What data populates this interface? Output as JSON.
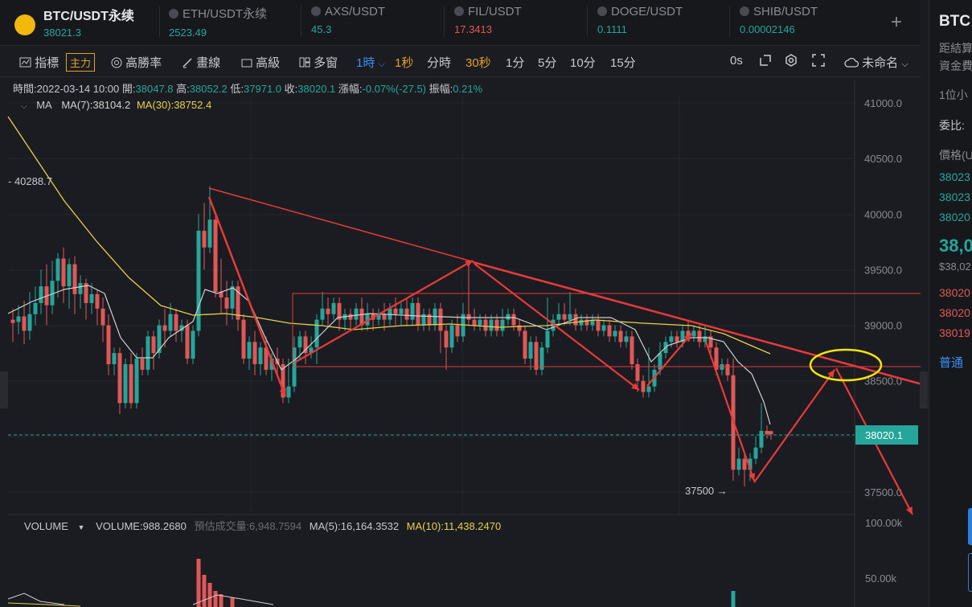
{
  "tickers": [
    {
      "name": "BTC/USDT永续",
      "price": "38021.3",
      "price_color": "#26a69a",
      "active": true
    },
    {
      "name": "ETH/USDT永续",
      "price": "2523.49",
      "price_color": "#26a69a"
    },
    {
      "name": "AXS/USDT",
      "price": "45.3",
      "price_color": "#26a69a"
    },
    {
      "name": "FIL/USDT",
      "price": "17.3413",
      "price_color": "#e05757"
    },
    {
      "name": "DOGE/USDT",
      "price": "0.1111",
      "price_color": "#26a69a"
    },
    {
      "name": "SHIB/USDT",
      "price": "0.00002146",
      "price_color": "#26a69a"
    }
  ],
  "toolbar": {
    "indicator": "指標",
    "main_badge": "主力",
    "win_rate": "高勝率",
    "draw": "畫線",
    "advanced": "高級",
    "multi_window": "多窗",
    "interval_selected": "1時",
    "intervals": [
      "1秒",
      "分時",
      "30秒",
      "1分",
      "5分",
      "10分",
      "15分"
    ],
    "time_display": "0s",
    "layout_name": "未命名"
  },
  "ohlc": {
    "time_label": "時間:",
    "time": "2022-03-14 10:00",
    "open_label": "開:",
    "open": "38047.8",
    "high_label": "高:",
    "high": "38052.2",
    "low_label": "低:",
    "low": "37971.0",
    "close_label": "收:",
    "close": "38020.1",
    "change_label": "漲幅:",
    "change": "-0.07%(-27.5)",
    "amp_label": "振幅:",
    "amp": "0.21%"
  },
  "ma": {
    "label": "MA",
    "ma7": "MA(7):38104.2",
    "ma30": "MA(30):38752.4"
  },
  "volume": {
    "label": "VOLUME",
    "value": "VOLUME:988.2680",
    "estimate": "預估成交量:6,948.7594",
    "ma5": "MA(5):16,164.3532",
    "ma10": "MA(10):11,438.2470"
  },
  "price_axis": [
    "41000.0",
    "40500.0",
    "40000.0",
    "39500.0",
    "39000.0",
    "38500.0",
    "37500.0"
  ],
  "price_axis_values": [
    41000,
    40500,
    40000,
    39500,
    39000,
    38500,
    37500
  ],
  "volume_axis": [
    "100.00k",
    "50.00k"
  ],
  "current_price": "38020.1",
  "high_marker": "40288.7",
  "low_marker": "37500",
  "colors": {
    "up": "#26a69a",
    "down": "#e05757",
    "ma7": "#d0d0d0",
    "ma30": "#e6d14a",
    "annotation": "#e83a3a",
    "circle": "#f2e600",
    "accent": "#3b8ff5"
  },
  "right_panel": {
    "symbol": "BTC",
    "settle": "距結算",
    "fee": "資金費",
    "precision": "1位小",
    "ratio": "委比:",
    "price_header": "價格(U",
    "asks_green": [
      "38023",
      "38023",
      "38020"
    ],
    "last": "38,0",
    "last_usd": "$38,02",
    "bids_red": [
      "38020",
      "38020",
      "38019"
    ],
    "normal": "普通"
  }
}
